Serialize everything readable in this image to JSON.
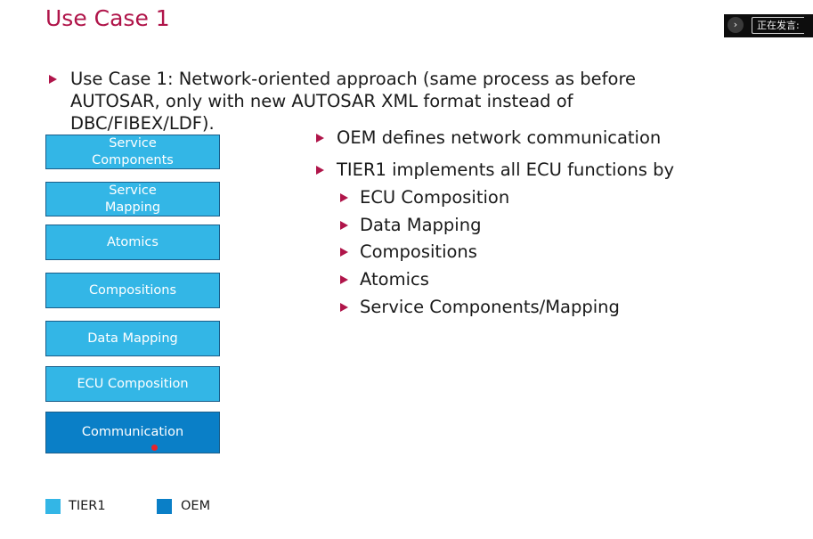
{
  "slide": {
    "title": "Use Case 1",
    "main_bullet": "Use Case 1: Network-oriented approach (same process as before\nAUTOSAR, only with new AUTOSAR XML format instead of\nDBC/FIBEX/LDF).",
    "bullets": [
      {
        "text": "OEM defines network communication",
        "level": 1
      },
      {
        "text": "TIER1 implements all ECU functions by",
        "level": 1
      },
      {
        "text": "ECU Composition",
        "level": 2
      },
      {
        "text": "Data Mapping",
        "level": 2
      },
      {
        "text": "Compositions",
        "level": 2
      },
      {
        "text": "Atomics",
        "level": 2
      },
      {
        "text": "Service Components/Mapping",
        "level": 2
      }
    ],
    "stack": [
      {
        "line1": "Service",
        "line2": "Components",
        "owner": "TIER1"
      },
      {
        "line1": "Service",
        "line2": "Mapping",
        "owner": "TIER1"
      },
      {
        "line1": "Atomics",
        "owner": "TIER1"
      },
      {
        "line1": "Compositions",
        "owner": "TIER1"
      },
      {
        "line1": "Data Mapping",
        "owner": "TIER1"
      },
      {
        "line1": "ECU Composition",
        "owner": "TIER1"
      },
      {
        "line1": "Communication",
        "owner": "OEM"
      }
    ],
    "legend": [
      {
        "label": "TIER1",
        "color": "#33b6e6"
      },
      {
        "label": "OEM",
        "color": "#0a7fc7"
      }
    ]
  },
  "overlay": {
    "speaking_label": "正在发言:",
    "expand_icon": "chevron-right-icon"
  },
  "colors": {
    "title": "#b0154a",
    "bullet_marker": "#b0154a",
    "tier1": "#33b6e6",
    "oem": "#0a7fc7"
  }
}
